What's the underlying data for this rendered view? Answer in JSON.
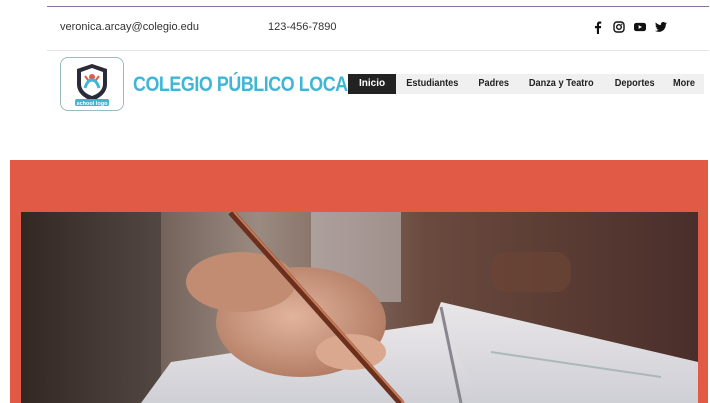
{
  "header": {
    "email": "veronica.arcay@colegio.edu",
    "phone": "123-456-7890",
    "social": [
      "facebook-icon",
      "instagram-icon",
      "youtube-icon",
      "twitter-icon"
    ]
  },
  "brand": {
    "logo_text": "school logo",
    "name": "COLEGIO PÚBLICO LOCAL",
    "name_color": "#3fb6d6"
  },
  "nav": {
    "items": [
      "Inicio",
      "Estudiantes",
      "Padres",
      "Danza y Teatro",
      "Deportes",
      "More"
    ],
    "active": "Inicio"
  },
  "colors": {
    "hero_background": "#e05a46",
    "nav_active": "#222222"
  }
}
